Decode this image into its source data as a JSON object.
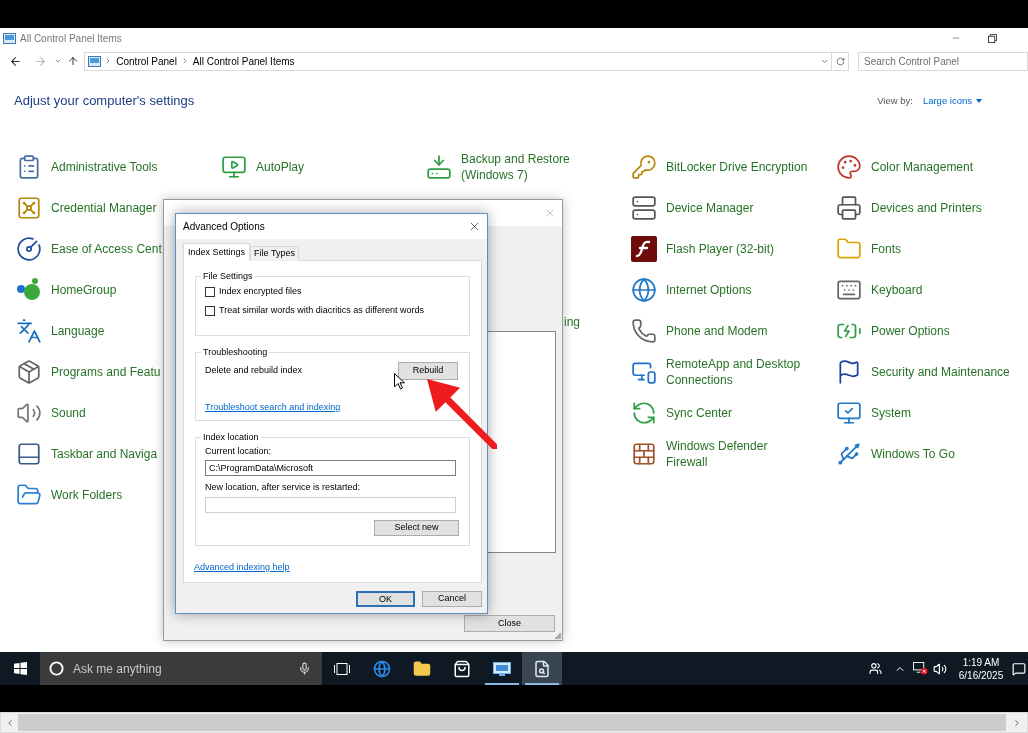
{
  "window": {
    "title": "All Control Panel Items"
  },
  "address_bar": {
    "breadcrumbs": [
      "Control Panel",
      "All Control Panel Items"
    ]
  },
  "search": {
    "placeholder": "Search Control Panel"
  },
  "heading": "Adjust your computer's settings",
  "view_by": {
    "label": "View by:",
    "value": "Large icons"
  },
  "control_panel": {
    "columns": [
      {
        "items": [
          {
            "label": "Administrative Tools"
          },
          {
            "label": "Credential Manager"
          },
          {
            "label": "Ease of Access Cent"
          },
          {
            "label": "HomeGroup"
          },
          {
            "label": "Language"
          },
          {
            "label": "Programs and Featu"
          },
          {
            "label": "Sound"
          },
          {
            "label": "Taskbar and Naviga"
          },
          {
            "label": "Work Folders"
          }
        ]
      },
      {
        "items": [
          {
            "label": "AutoPlay"
          }
        ]
      },
      {
        "items": [
          {
            "label": "Backup and Restore (Windows 7)"
          }
        ]
      },
      {
        "items": [
          {
            "label": "BitLocker Drive Encryption"
          },
          {
            "label": "Device Manager"
          },
          {
            "label": "Flash Player (32-bit)"
          },
          {
            "label": "Internet Options"
          },
          {
            "label": "Phone and Modem"
          },
          {
            "label": "RemoteApp and Desktop Connections"
          },
          {
            "label": "Sync Center"
          },
          {
            "label": "Windows Defender Firewall"
          }
        ]
      },
      {
        "items": [
          {
            "label": "Color Management"
          },
          {
            "label": "Devices and Printers"
          },
          {
            "label": "Fonts"
          },
          {
            "label": "Keyboard"
          },
          {
            "label": "Power Options"
          },
          {
            "label": "Security and Maintenance"
          },
          {
            "label": "System"
          },
          {
            "label": "Windows To Go"
          }
        ]
      }
    ],
    "covered_fragment": "ing"
  },
  "indexing_options": {
    "close_button": "Close"
  },
  "advanced_options": {
    "title": "Advanced Options",
    "tabs": [
      {
        "label": "Index Settings",
        "selected": true
      },
      {
        "label": "File Types",
        "selected": false
      }
    ],
    "file_settings": {
      "title": "File Settings",
      "options": [
        {
          "label": "Index encrypted files",
          "checked": false
        },
        {
          "label": "Treat similar words with diacritics as different words",
          "checked": false
        }
      ]
    },
    "troubleshooting": {
      "title": "Troubleshooting",
      "label": "Delete and rebuild index",
      "button": "Rebuild",
      "link": "Troubleshoot search and indexing"
    },
    "index_location": {
      "title": "Index location",
      "current_label": "Current location:",
      "current_value": "C:\\ProgramData\\Microsoft",
      "new_label": "New location, after service is restarted:",
      "button": "Select new"
    },
    "help_link": "Advanced indexing help",
    "buttons": [
      {
        "label": "OK",
        "default": true
      },
      {
        "label": "Cancel",
        "default": false
      }
    ]
  },
  "taskbar": {
    "search_placeholder": "Ask me anything",
    "apps": [
      {
        "running": false,
        "focused": false
      },
      {
        "running": false,
        "focused": false
      },
      {
        "running": false,
        "focused": false
      },
      {
        "running": false,
        "focused": false
      },
      {
        "running": true,
        "focused": false
      },
      {
        "running": true,
        "focused": true
      }
    ],
    "clock": {
      "time": "1:19 AM",
      "date": "6/16/2025"
    }
  }
}
